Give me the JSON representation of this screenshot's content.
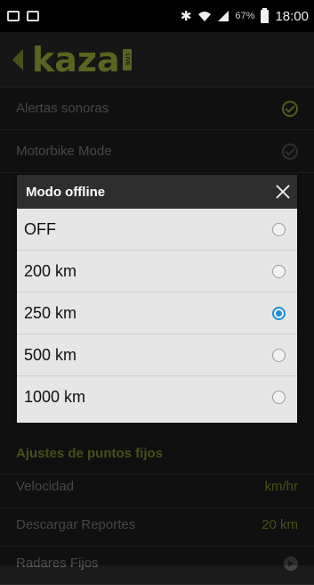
{
  "status_bar": {
    "battery_percent": "67%",
    "time": "18:00",
    "icons": [
      "screenshot-icon",
      "gallery-icon",
      "bluetooth-icon",
      "wifi-icon",
      "signal-icon",
      "battery-icon"
    ]
  },
  "header": {
    "logo_text": "kaza",
    "logo_badge": "LIVE"
  },
  "settings": {
    "rows": [
      {
        "label": "Alertas sonoras",
        "checked": true
      },
      {
        "label": "Motorbike Mode",
        "checked": false
      }
    ]
  },
  "section": {
    "title": "Ajustes de puntos fijos",
    "rows": [
      {
        "label": "Velocidad",
        "value": "km/hr"
      },
      {
        "label": "Descargar Reportes",
        "value": "20 km"
      },
      {
        "label": "Radares Fijos",
        "value": ""
      }
    ]
  },
  "dialog": {
    "title": "Modo offline",
    "options": [
      {
        "label": "OFF",
        "selected": false
      },
      {
        "label": "200 km",
        "selected": false
      },
      {
        "label": "250 km",
        "selected": true
      },
      {
        "label": "500 km",
        "selected": false
      },
      {
        "label": "1000 km",
        "selected": false
      }
    ]
  },
  "colors": {
    "accent": "#8c9a33",
    "radio_selected": "#1a8fd8"
  }
}
